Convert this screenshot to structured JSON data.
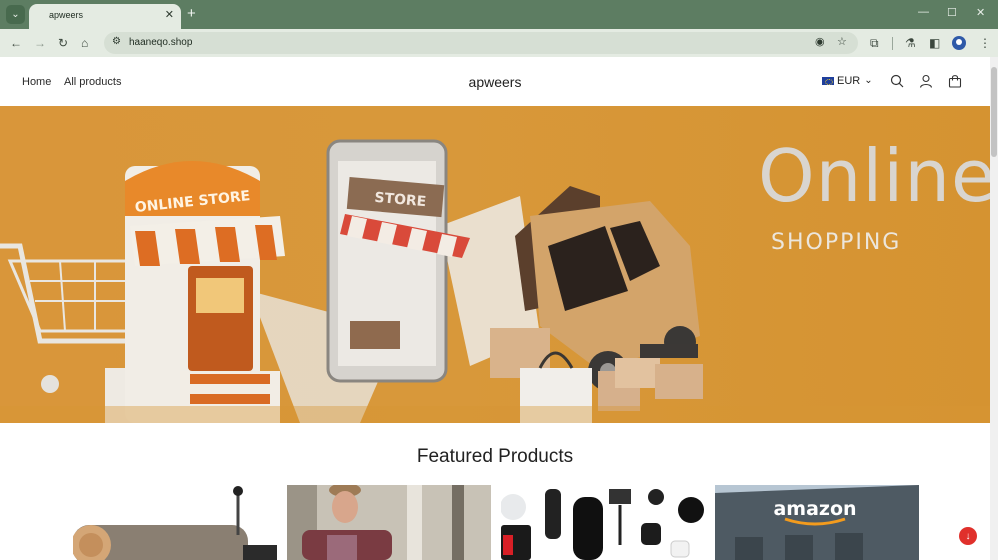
{
  "browser": {
    "tab_title": "apweers",
    "new_tab": "+",
    "url": "haaneqo.shop",
    "icons": {
      "back": "←",
      "forward": "→",
      "reload": "↻",
      "home": "⌂",
      "tune": "⚙",
      "eye_off": "◉",
      "star": "☆",
      "extensions": "⧉",
      "labs": "⚗",
      "sidebar": "◧",
      "menu": "⋮",
      "tab_search": "⌄",
      "close": "✕",
      "minimize": "—",
      "maximize": "☐"
    }
  },
  "site": {
    "logo": "apweers",
    "nav": [
      "Home",
      "All products"
    ],
    "currency": "EUR",
    "chevron": "⌄"
  },
  "hero": {
    "title": "Online.",
    "subtitle": "SHOPPING",
    "store_sign": "ONLINE STORE",
    "phone_sign": "STORE"
  },
  "featured": {
    "title": "Featured Products",
    "product_sign": "amazon"
  },
  "colors": {
    "hero_bg": "#d69533",
    "browser_frame": "#5d7d62",
    "chat": "#e0302b"
  }
}
